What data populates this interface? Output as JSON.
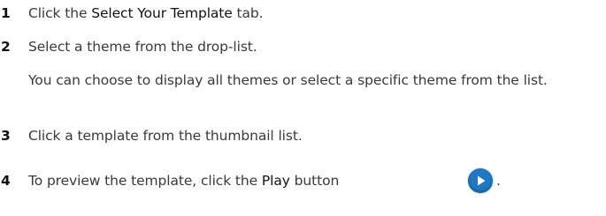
{
  "steps": [
    {
      "number": "1",
      "before": "Click the ",
      "bold": "Select Your Template",
      "after": " tab."
    },
    {
      "number": "2",
      "text": "Select a theme from the drop-list.",
      "note": "You can choose to display all themes or select a specific theme from the list."
    },
    {
      "number": "3",
      "text": "Click a template from the thumbnail list."
    },
    {
      "number": "4",
      "before": "To preview the template, click the ",
      "bold": "Play",
      "after": " button",
      "end": ".",
      "icon": "play-icon"
    }
  ],
  "colors": {
    "icon_blue": "#1d78c5",
    "text": "#3a3a3a",
    "number": "#111111"
  }
}
